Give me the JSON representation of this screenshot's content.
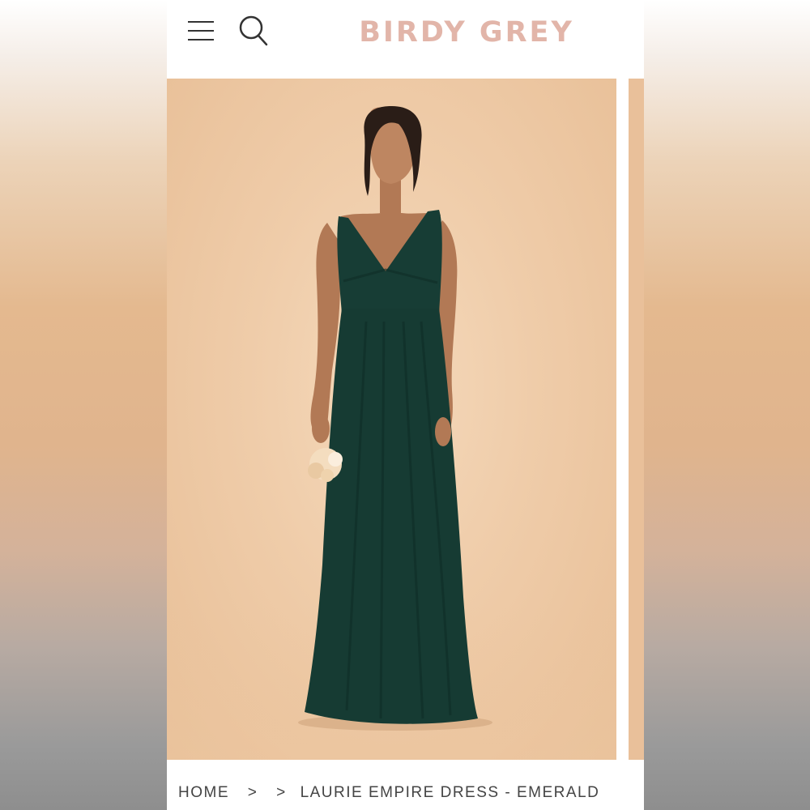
{
  "brand": {
    "name": "BIRDY GREY",
    "color": "#e2b5a9"
  },
  "header": {
    "menu_icon": "hamburger-menu-icon",
    "search_icon": "search-icon"
  },
  "hero": {
    "background_color": "#efcca9",
    "dress_color": "#173d35"
  },
  "breadcrumb": {
    "home": "HOME",
    "separator": ">",
    "current": "LAURIE EMPIRE DRESS - EMERALD"
  }
}
